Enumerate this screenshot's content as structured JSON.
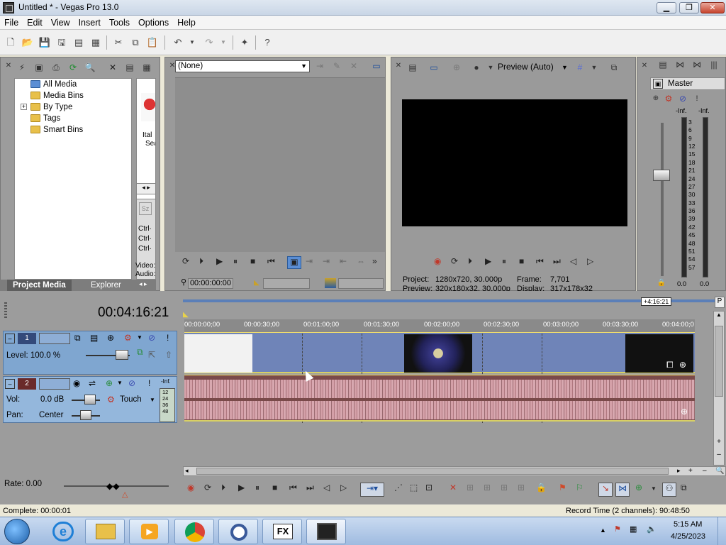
{
  "window": {
    "title": "Untitled * - Vegas Pro 13.0",
    "minimize": "▁",
    "restore": "❐",
    "close": "✕"
  },
  "menu": [
    "File",
    "Edit",
    "View",
    "Insert",
    "Tools",
    "Options",
    "Help"
  ],
  "explorer": {
    "tree": [
      {
        "label": "All Media",
        "selected": true
      },
      {
        "label": "Media Bins"
      },
      {
        "label": "By Type",
        "expandable": true
      },
      {
        "label": "Tags"
      },
      {
        "label": "Smart Bins"
      }
    ],
    "thumb_label1": "Ital",
    "thumb_label2": "Sea",
    "ctrl1": "Ctrl·",
    "ctrl2": "Ctrl·",
    "ctrl3": "Ctrl·",
    "video_label": "Video:",
    "audio_label": "Audio:",
    "tabs": {
      "project_media": "Project Media",
      "explorer": "Explorer"
    }
  },
  "trimmer": {
    "source_dropdown": "(None)",
    "timecode": "00:00:00:00"
  },
  "preview": {
    "mode_dropdown": "Preview (Auto)",
    "project_label": "Project:",
    "project_value": "1280x720, 30.000p",
    "preview_label": "Preview:",
    "preview_value": "320x180x32, 30.000p",
    "frame_label": "Frame:",
    "frame_value": "7,701",
    "display_label": "Display:",
    "display_value": "317x178x32"
  },
  "mixer": {
    "master_label": "Master",
    "peak_left": "-Inf.",
    "peak_right": "-Inf.",
    "scale": [
      "3",
      "6",
      "9",
      "12",
      "15",
      "18",
      "21",
      "24",
      "27",
      "30",
      "33",
      "36",
      "39",
      "42",
      "45",
      "48",
      "51",
      "54",
      "57"
    ],
    "level_left": "0.0",
    "level_right": "0.0"
  },
  "timeline": {
    "position": "00:04:16:21",
    "end_marker": "+4:16:21",
    "ruler": [
      "00:00:00;00",
      "00:00:30;00",
      "00:01:00;00",
      "00:01:30;00",
      "00:02:00;00",
      "00:02:30;00",
      "00:03:00;00",
      "00:03:30;00",
      "00:04:00;0"
    ],
    "video_track": {
      "number": "1",
      "level": "Level: 100.0 %"
    },
    "audio_track": {
      "number": "2",
      "vol_label": "Vol:",
      "vol_value": "0.0 dB",
      "pan_label": "Pan:",
      "pan_value": "Center",
      "automation": "Touch",
      "meter_inf": "-Inf.",
      "meter_ticks": [
        "12",
        "24",
        "36",
        "48"
      ]
    },
    "rate": "Rate: 0.00"
  },
  "status": {
    "left": "Complete: 00:00:01",
    "right": "Record Time (2 channels): 90:48:50"
  },
  "taskbar": {
    "time": "5:15 AM",
    "date": "4/25/2023",
    "fx_label": "FX"
  },
  "colors": {
    "accent_blue": "#7fa6d0",
    "video_track": "#6f84b8",
    "audio_track": "#7a4a4a",
    "record_red": "#c0392b"
  }
}
